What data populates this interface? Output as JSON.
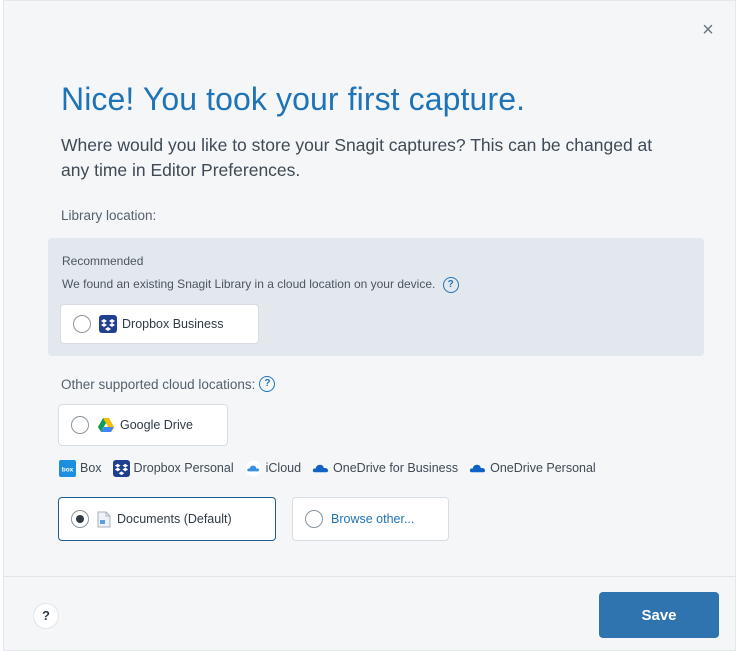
{
  "dialog": {
    "close_label": "×",
    "title": "Nice! You took your first capture.",
    "subtitle": "Where would you like to store your Snagit captures? This can be changed at any time in Editor Preferences."
  },
  "library": {
    "label": "Library location:",
    "recommended": {
      "title": "Recommended",
      "description": "We found an existing Snagit Library in a cloud location on your device.",
      "help_glyph": "?",
      "option": {
        "label": "Dropbox Business",
        "icon": "dropbox-icon",
        "selected": false
      }
    },
    "other": {
      "label": "Other supported cloud locations:",
      "help_glyph": "?",
      "google_drive": {
        "label": "Google Drive",
        "icon": "google-drive-icon",
        "selected": false
      },
      "services": [
        {
          "label": "Box",
          "icon": "box-icon"
        },
        {
          "label": "Dropbox Personal",
          "icon": "dropbox-icon"
        },
        {
          "label": "iCloud",
          "icon": "icloud-icon"
        },
        {
          "label": "OneDrive for Business",
          "icon": "onedrive-icon"
        },
        {
          "label": "OneDrive Personal",
          "icon": "onedrive-icon"
        }
      ]
    },
    "documents": {
      "label": "Documents (Default)",
      "icon": "document-icon",
      "selected": true
    },
    "browse": {
      "label": "Browse other...",
      "selected": false
    }
  },
  "footer": {
    "help_label": "?",
    "save_label": "Save"
  },
  "colors": {
    "accent": "#1f73b7",
    "save_button": "#2f74ae",
    "dropbox": "#1f3f8f",
    "box": "#1d8fe0",
    "onedrive": "#1062c4"
  }
}
